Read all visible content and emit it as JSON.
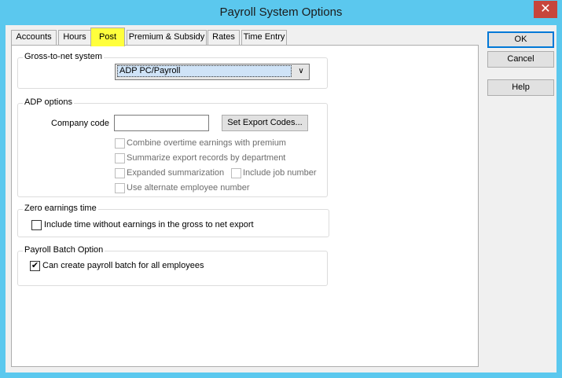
{
  "window": {
    "title": "Payroll System Options",
    "close_glyph": "✕"
  },
  "tabs": [
    {
      "label": "Accounts"
    },
    {
      "label": "Hours"
    },
    {
      "label": "Post"
    },
    {
      "label": "Premium & Subsidy"
    },
    {
      "label": "Rates"
    },
    {
      "label": "Time Entry"
    }
  ],
  "active_tab": "Post",
  "buttons": {
    "ok": "OK",
    "cancel": "Cancel",
    "help": "Help"
  },
  "gross_to_net": {
    "legend": "Gross-to-net system",
    "selected": "ADP PC/Payroll",
    "arrow_glyph": "∨"
  },
  "adp_options": {
    "legend": "ADP options",
    "company_code_label": "Company code",
    "company_code_value": "",
    "export_button": "Set Export Codes...",
    "checkboxes": [
      {
        "label": "Combine overtime earnings with premium",
        "checked": false,
        "enabled": false
      },
      {
        "label": "Summarize export records by department",
        "checked": false,
        "enabled": false
      },
      {
        "label": "Expanded summarization",
        "checked": false,
        "enabled": false
      },
      {
        "label": "Include job number",
        "checked": false,
        "enabled": false
      },
      {
        "label": "Use alternate employee number",
        "checked": false,
        "enabled": false
      }
    ]
  },
  "zero_earnings": {
    "legend": "Zero earnings time",
    "checkbox": {
      "label": "Include time without earnings in the gross to net export",
      "checked": false
    }
  },
  "payroll_batch": {
    "legend": "Payroll Batch Option",
    "checkbox": {
      "label": "Can create payroll batch for all employees",
      "checked": true,
      "mark": "✔"
    }
  },
  "colors": {
    "titlebar": "#5bc8ee",
    "highlight_tab": "#ffff3c",
    "close": "#c7453c"
  }
}
